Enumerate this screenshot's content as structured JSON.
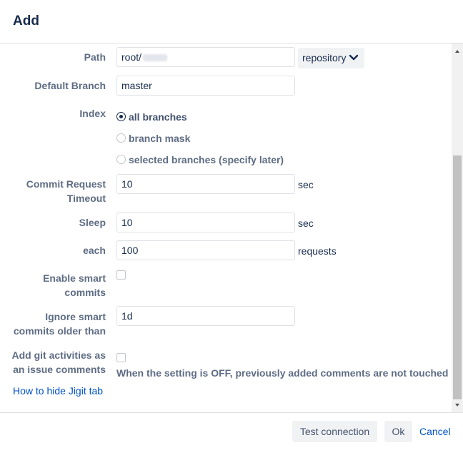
{
  "dialog": {
    "title": "Add"
  },
  "form": {
    "path": {
      "label": "Path",
      "value": "root/",
      "type_select": "repository"
    },
    "default_branch": {
      "label": "Default Branch",
      "value": "master"
    },
    "index": {
      "label": "Index",
      "options": [
        {
          "label": "all branches",
          "checked": true
        },
        {
          "label": "branch mask",
          "checked": false
        },
        {
          "label": "selected branches (specify later)",
          "checked": false
        }
      ]
    },
    "commit_request_timeout": {
      "label_line1": "Commit Request",
      "label_line2": "Timeout",
      "value": "10",
      "unit": "sec"
    },
    "sleep": {
      "label": "Sleep",
      "value": "10",
      "unit": "sec"
    },
    "each": {
      "label": "each",
      "value": "100",
      "unit": "requests"
    },
    "enable_smart_commits": {
      "label_line1": "Enable smart",
      "label_line2": "commits",
      "checked": false
    },
    "ignore_smart_commits": {
      "label_line1": "Ignore smart",
      "label_line2": "commits older than",
      "value": "1d"
    },
    "add_git_activities": {
      "label_line1": "Add git activities as",
      "label_line2": "an issue comments",
      "checked": false,
      "note": "When the setting is OFF, previously added comments are not touched"
    },
    "help_link": "How to hide Jigit tab"
  },
  "footer": {
    "test_connection": "Test connection",
    "ok": "Ok",
    "cancel": "Cancel"
  },
  "icons": {
    "chevron": "chevron-down-icon",
    "scroll_up": "arrow-up-icon",
    "scroll_down": "arrow-down-icon"
  }
}
